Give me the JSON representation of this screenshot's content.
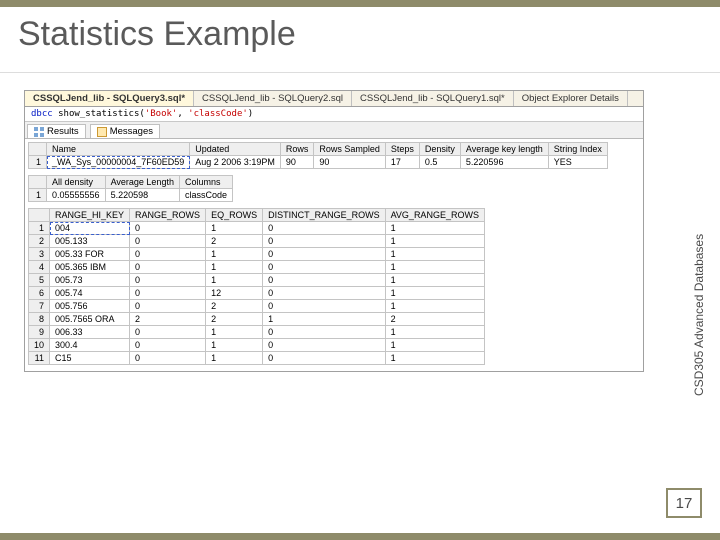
{
  "slide": {
    "title": "Statistics Example",
    "side_label": "CSD305 Advanced Databases",
    "page_number": "17"
  },
  "tabs": [
    "CSSQLJend_lib - SQLQuery3.sql*",
    "CSSQLJend_lib - SQLQuery2.sql",
    "CSSQLJend_lib - SQLQuery1.sql*",
    "Object Explorer Details"
  ],
  "query": {
    "kw1": "dbcc",
    "fn": "show_statistics",
    "open": "(",
    "arg1": "'Book'",
    "comma": ", ",
    "arg2": "'classCode'",
    "close": ")"
  },
  "restabs": {
    "results": "Results",
    "messages": "Messages"
  },
  "grid1": {
    "headers": [
      "",
      "Name",
      "Updated",
      "Rows",
      "Rows Sampled",
      "Steps",
      "Density",
      "Average key length",
      "String Index"
    ],
    "rows": [
      [
        "1",
        "_WA_Sys_00000004_7F60ED59",
        "Aug  2 2006  3:19PM",
        "90",
        "90",
        "17",
        "0.5",
        "5.220596",
        "YES"
      ]
    ]
  },
  "grid2": {
    "headers": [
      "",
      "All density",
      "Average Length",
      "Columns"
    ],
    "rows": [
      [
        "1",
        "0.05555556",
        "5.220598",
        "classCode"
      ]
    ]
  },
  "grid3": {
    "headers": [
      "",
      "RANGE_HI_KEY",
      "RANGE_ROWS",
      "EQ_ROWS",
      "DISTINCT_RANGE_ROWS",
      "AVG_RANGE_ROWS"
    ],
    "rows": [
      [
        "1",
        "004",
        "0",
        "1",
        "0",
        "1"
      ],
      [
        "2",
        "005.133",
        "0",
        "2",
        "0",
        "1"
      ],
      [
        "3",
        "005.33 FOR",
        "0",
        "1",
        "0",
        "1"
      ],
      [
        "4",
        "005.365 IBM",
        "0",
        "1",
        "0",
        "1"
      ],
      [
        "5",
        "005.73",
        "0",
        "1",
        "0",
        "1"
      ],
      [
        "6",
        "005.74",
        "0",
        "12",
        "0",
        "1"
      ],
      [
        "7",
        "005.756",
        "0",
        "2",
        "0",
        "1"
      ],
      [
        "8",
        "005.7565 ORA",
        "2",
        "2",
        "1",
        "2"
      ],
      [
        "9",
        "006.33",
        "0",
        "1",
        "0",
        "1"
      ],
      [
        "10",
        "300.4",
        "0",
        "1",
        "0",
        "1"
      ],
      [
        "11",
        "C15",
        "0",
        "1",
        "0",
        "1"
      ]
    ]
  }
}
